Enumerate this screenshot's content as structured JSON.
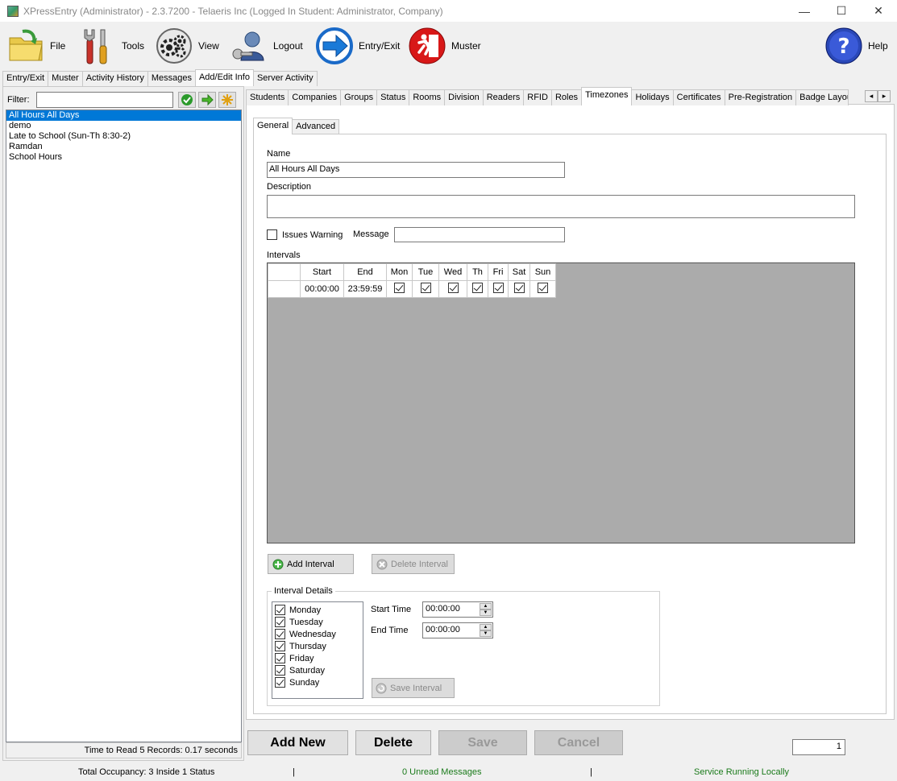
{
  "window": {
    "title": "XPressEntry (Administrator)  - 2.3.7200 - Telaeris Inc (Logged In Student: Administrator, Company)",
    "controls": {
      "minimize": "—",
      "maximize": "☐",
      "close": "✕"
    }
  },
  "toolbar": {
    "file": "File",
    "tools": "Tools",
    "view": "View",
    "logout": "Logout",
    "entry_exit": "Entry/Exit",
    "muster": "Muster",
    "help": "Help"
  },
  "main_tabs": [
    "Entry/Exit",
    "Muster",
    "Activity History",
    "Messages",
    "Add/Edit Info",
    "Server Activity"
  ],
  "main_tab_active": "Add/Edit Info",
  "left": {
    "filter_label": "Filter:",
    "filter_value": "",
    "items": [
      "All Hours All Days",
      "demo",
      "Late to School (Sun-Th 8:30-2)",
      "Ramdan",
      "School Hours"
    ],
    "selected_index": 0,
    "status": "Time to Read 5 Records: 0.17 seconds"
  },
  "sub_tabs": [
    "Students",
    "Companies",
    "Groups",
    "Status",
    "Rooms",
    "Division",
    "Readers",
    "RFID",
    "Roles",
    "Timezones",
    "Holidays",
    "Certificates",
    "Pre-Registration",
    "Badge Layou"
  ],
  "sub_tab_active": "Timezones",
  "scroll": {
    "left": "◂",
    "right": "▸"
  },
  "inner_tabs": [
    "General",
    "Advanced"
  ],
  "form": {
    "name_label": "Name",
    "name_value": "All Hours All Days",
    "description_label": "Description",
    "description_value": "",
    "issues_warning_label": "Issues Warning",
    "issues_warning_checked": false,
    "message_label": "Message",
    "message_value": "",
    "intervals_label": "Intervals"
  },
  "intervals": {
    "columns": [
      "Start",
      "End",
      "Mon",
      "Tue",
      "Wed",
      "Th",
      "Fri",
      "Sat",
      "Sun"
    ],
    "rows": [
      {
        "start": "00:00:00",
        "end": "23:59:59",
        "days": [
          true,
          true,
          true,
          true,
          true,
          true,
          true
        ]
      }
    ]
  },
  "interval_buttons": {
    "add": "Add Interval",
    "delete": "Delete Interval"
  },
  "interval_details": {
    "title": "Interval Details",
    "days": [
      {
        "label": "Monday",
        "checked": true
      },
      {
        "label": "Tuesday",
        "checked": true
      },
      {
        "label": "Wednesday",
        "checked": true
      },
      {
        "label": "Thursday",
        "checked": true
      },
      {
        "label": "Friday",
        "checked": true
      },
      {
        "label": "Saturday",
        "checked": true
      },
      {
        "label": "Sunday",
        "checked": true
      }
    ],
    "start_time_label": "Start Time",
    "start_time_value": "00:00:00",
    "end_time_label": "End Time",
    "end_time_value": "00:00:00",
    "save_interval": "Save Interval"
  },
  "actions": {
    "add_new": "Add New",
    "delete": "Delete",
    "save": "Save",
    "cancel": "Cancel",
    "record_number": "1"
  },
  "statusbar": {
    "occupancy": "Total Occupancy: 3 Inside 1 Status",
    "sep1": "|",
    "messages": "0 Unread Messages",
    "sep2": "|",
    "service": "Service Running Locally"
  },
  "colors": {
    "selection": "#0078d7",
    "grid_bg": "#ababab",
    "status_green": "#1a7a1a"
  }
}
